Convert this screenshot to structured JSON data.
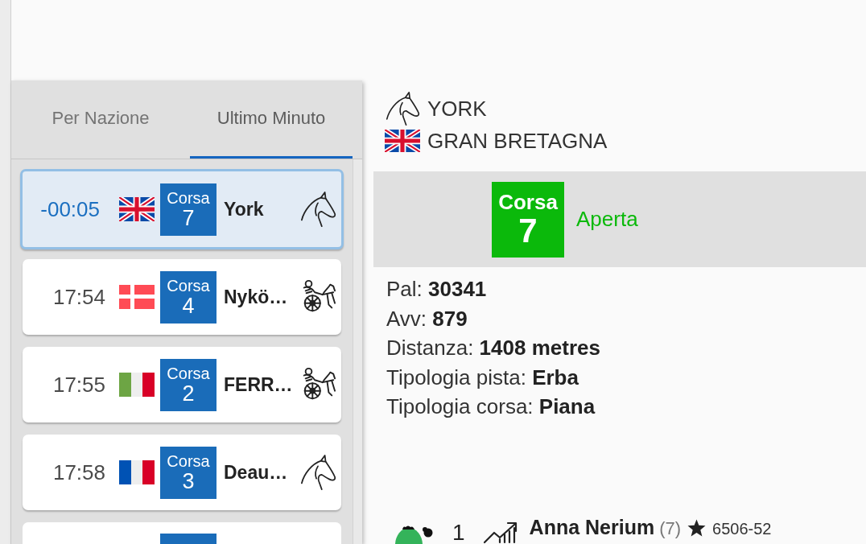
{
  "tabs": [
    {
      "label": "Per Nazione",
      "selected": false
    },
    {
      "label": "Ultimo Minuto",
      "selected": true
    }
  ],
  "races": [
    {
      "kind": "gallop",
      "selected": true,
      "time": "-00:05",
      "badge_label": "Corsa",
      "number": "7",
      "name": "York"
    },
    {
      "kind": "trot",
      "selected": false,
      "time": "17:54",
      "badge_label": "Corsa",
      "number": "4",
      "name": "Nykö…"
    },
    {
      "kind": "trot",
      "selected": false,
      "time": "17:55",
      "badge_label": "Corsa",
      "number": "2",
      "name": "FERR…"
    },
    {
      "kind": "gallop",
      "selected": false,
      "time": "17:58",
      "badge_label": "Corsa",
      "number": "3",
      "name": "Deau…"
    },
    {
      "kind": "partial",
      "selected": false
    }
  ],
  "detail": {
    "venue": "YORK",
    "country": "GRAN BRETAGNA",
    "status": {
      "open": true,
      "badge_label": "Corsa",
      "number": "7",
      "text": "Aperta"
    },
    "info": [
      "Pal: **30341**",
      "Avv: **879**",
      "Distanza: **1408 metres**",
      "Tipologia pista: **Erba**",
      "Tipologia corsa: **Piana**"
    ],
    "runner": {
      "number": "1",
      "name": "Anna Nerium",
      "draw": "(7)",
      "form": "6506-52"
    }
  }
}
